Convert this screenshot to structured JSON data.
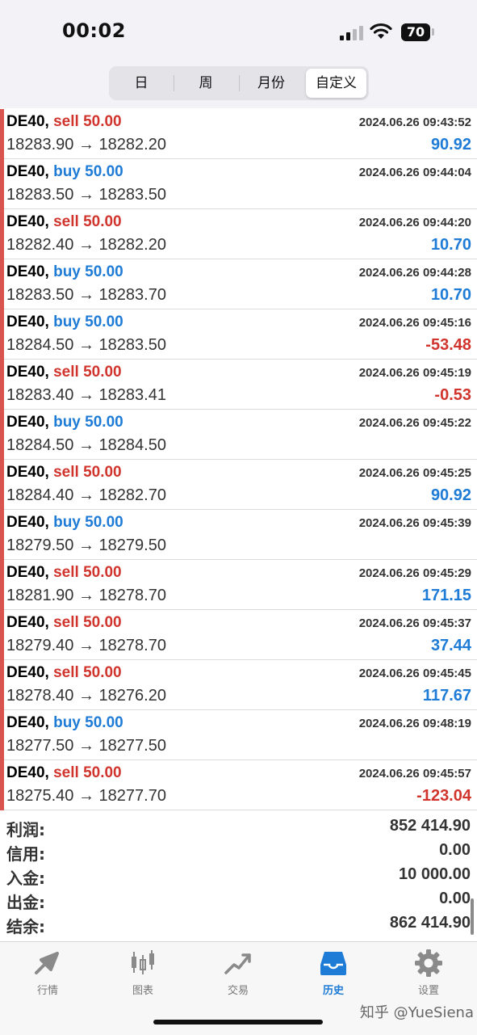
{
  "status_bar": {
    "time": "00:02",
    "battery": "70"
  },
  "segments": [
    {
      "label": "日",
      "active": false
    },
    {
      "label": "周",
      "active": false
    },
    {
      "label": "月份",
      "active": false
    },
    {
      "label": "自定义",
      "active": true
    }
  ],
  "trades": [
    {
      "symbol": "DE40,",
      "side": "sell",
      "volume": "sell 50.00",
      "datetime": "2024.06.26 09:43:52",
      "prices": "18283.90 → 18282.20",
      "profit": "90.92"
    },
    {
      "symbol": "DE40,",
      "side": "buy",
      "volume": "buy 50.00",
      "datetime": "2024.06.26 09:44:04",
      "prices": "18283.50 → 18283.50",
      "profit": ""
    },
    {
      "symbol": "DE40,",
      "side": "sell",
      "volume": "sell 50.00",
      "datetime": "2024.06.26 09:44:20",
      "prices": "18282.40 → 18282.20",
      "profit": "10.70"
    },
    {
      "symbol": "DE40,",
      "side": "buy",
      "volume": "buy 50.00",
      "datetime": "2024.06.26 09:44:28",
      "prices": "18283.50 → 18283.70",
      "profit": "10.70"
    },
    {
      "symbol": "DE40,",
      "side": "buy",
      "volume": "buy 50.00",
      "datetime": "2024.06.26 09:45:16",
      "prices": "18284.50 → 18283.50",
      "profit": "-53.48"
    },
    {
      "symbol": "DE40,",
      "side": "sell",
      "volume": "sell 50.00",
      "datetime": "2024.06.26 09:45:19",
      "prices": "18283.40 → 18283.41",
      "profit": "-0.53"
    },
    {
      "symbol": "DE40,",
      "side": "buy",
      "volume": "buy 50.00",
      "datetime": "2024.06.26 09:45:22",
      "prices": "18284.50 → 18284.50",
      "profit": ""
    },
    {
      "symbol": "DE40,",
      "side": "sell",
      "volume": "sell 50.00",
      "datetime": "2024.06.26 09:45:25",
      "prices": "18284.40 → 18282.70",
      "profit": "90.92"
    },
    {
      "symbol": "DE40,",
      "side": "buy",
      "volume": "buy 50.00",
      "datetime": "2024.06.26 09:45:39",
      "prices": "18279.50 → 18279.50",
      "profit": ""
    },
    {
      "symbol": "DE40,",
      "side": "sell",
      "volume": "sell 50.00",
      "datetime": "2024.06.26 09:45:29",
      "prices": "18281.90 → 18278.70",
      "profit": "171.15"
    },
    {
      "symbol": "DE40,",
      "side": "sell",
      "volume": "sell 50.00",
      "datetime": "2024.06.26 09:45:37",
      "prices": "18279.40 → 18278.70",
      "profit": "37.44"
    },
    {
      "symbol": "DE40,",
      "side": "sell",
      "volume": "sell 50.00",
      "datetime": "2024.06.26 09:45:45",
      "prices": "18278.40 → 18276.20",
      "profit": "117.67"
    },
    {
      "symbol": "DE40,",
      "side": "buy",
      "volume": "buy 50.00",
      "datetime": "2024.06.26 09:48:19",
      "prices": "18277.50 → 18277.50",
      "profit": ""
    },
    {
      "symbol": "DE40,",
      "side": "sell",
      "volume": "sell 50.00",
      "datetime": "2024.06.26 09:45:57",
      "prices": "18275.40 → 18277.70",
      "profit": "-123.04"
    }
  ],
  "summary": [
    {
      "label": "利润:",
      "value": "852 414.90"
    },
    {
      "label": "信用:",
      "value": "0.00"
    },
    {
      "label": "入金:",
      "value": "10 000.00"
    },
    {
      "label": "出金:",
      "value": "0.00"
    },
    {
      "label": "结余:",
      "value": "862 414.90"
    }
  ],
  "tabs": [
    {
      "label": "行情",
      "icon": "quotes-icon",
      "active": false
    },
    {
      "label": "图表",
      "icon": "chart-icon",
      "active": false
    },
    {
      "label": "交易",
      "icon": "trade-icon",
      "active": false
    },
    {
      "label": "历史",
      "icon": "history-icon",
      "active": true
    },
    {
      "label": "设置",
      "icon": "settings-icon",
      "active": false
    }
  ],
  "watermark": "知乎 @YueSiena",
  "colors": {
    "sell": "#d0342c",
    "buy": "#1e7bd6",
    "active_tab": "#1e7bd6",
    "inactive_tab": "#777777"
  }
}
